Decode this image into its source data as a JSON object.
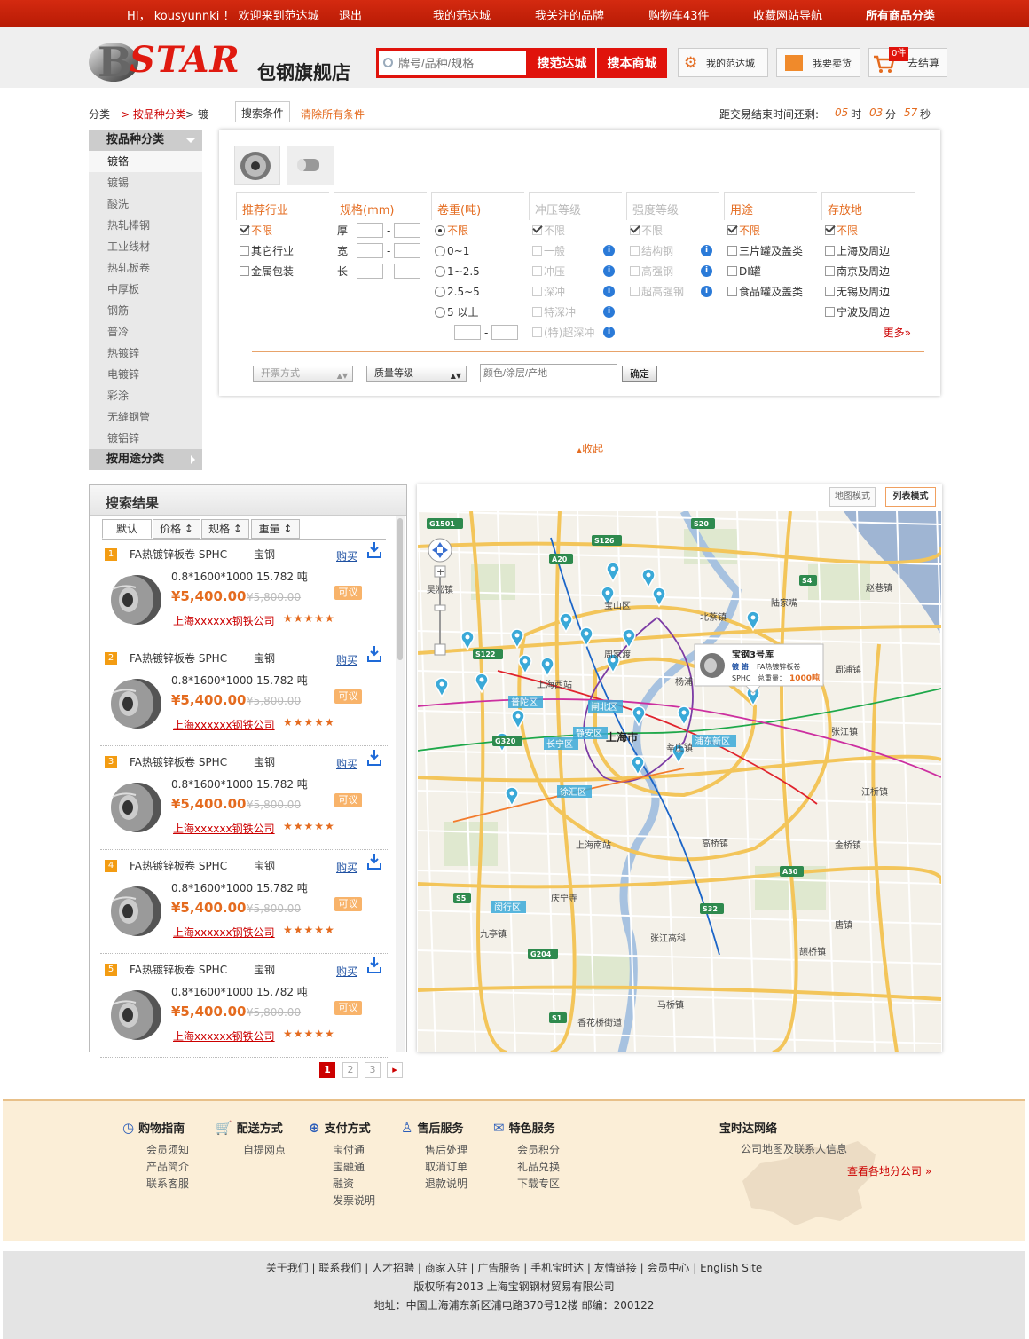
{
  "topbar": {
    "greeting": "HI， kousyunnki ！ 欢迎来到范达城",
    "logout": "退出",
    "my_fanda": "我的范达城",
    "followed_brands": "我关注的品牌",
    "cart": "购物车43件",
    "fav_nav": "收藏网站导航",
    "all_categories": "所有商品分类"
  },
  "header": {
    "logo_text": "STAR",
    "logo_cn": "包钢旗舰店",
    "search_placeholder": "牌号/品种/规格",
    "search_fanda": "搜范达城",
    "search_store": "搜本商城",
    "my_fanda_btn": "我的范达城",
    "sell_btn": "我要卖货",
    "cart_count": "0件",
    "checkout_btn": "去结算"
  },
  "breadcrumb": {
    "root": "分类",
    "level1": "> 按品种分类",
    "level2": "> 镀",
    "search_cond": "搜索条件",
    "clear_all": "清除所有条件",
    "countdown_label": "距交易结束时间还剩:",
    "hours": "05",
    "hours_unit": "时",
    "minutes": "03",
    "minutes_unit": "分",
    "seconds": "57",
    "seconds_unit": "秒"
  },
  "leftcat": {
    "head1": "按品种分类",
    "items": [
      "镀铬",
      "镀锡",
      "酸洗",
      "热轧棒钢",
      "工业线材",
      "热轧板卷",
      "中厚板",
      "钢筋",
      "普冷",
      "热镀锌",
      "电镀锌",
      "彩涂",
      "无缝钢管",
      "镀铝锌"
    ],
    "head2": "按用途分类"
  },
  "filter": {
    "industry": {
      "title": "推荐行业",
      "opts": [
        "不限",
        "其它行业",
        "金属包装"
      ]
    },
    "spec": {
      "title": "规格(mm)",
      "thick": "厚",
      "width": "宽",
      "length": "长",
      "dash": "-"
    },
    "weight": {
      "title": "卷重(吨)",
      "opts": [
        "不限",
        "0~1",
        "1~2.5",
        "2.5~5",
        "5 以上"
      ],
      "dash": "-"
    },
    "stamping": {
      "title": "冲压等级",
      "opts": [
        "不限",
        "一般",
        "冲压",
        "深冲",
        "特深冲",
        "(特)超深冲"
      ]
    },
    "strength": {
      "title": "强度等级",
      "opts": [
        "不限",
        "结构钢",
        "高强钢",
        "超高强钢"
      ]
    },
    "usage": {
      "title": "用途",
      "opts": [
        "不限",
        "三片罐及盖类",
        "DI罐",
        "食品罐及盖类"
      ]
    },
    "location": {
      "title": "存放地",
      "opts": [
        "不限",
        "上海及周边",
        "南京及周边",
        "无锡及周边",
        "宁波及周边"
      ],
      "more": "更多»"
    },
    "invoice_select": "开票方式",
    "quality_select": "质量等级",
    "extra_placeholder": "颜色/涂层/产地",
    "confirm": "确定",
    "collapse": "收起"
  },
  "results": {
    "title": "搜索结果",
    "sorts": [
      "默认",
      "价格 ↕",
      "规格 ↕",
      "重量 ↕"
    ],
    "items": [
      {
        "num": "1",
        "name": "FA热镀锌板卷 SPHC",
        "brand": "宝钢",
        "buy": "购买",
        "spec": "0.8*1600*1000   15.782 吨",
        "price": "¥5,400.00",
        "old_price": "¥5,800.00",
        "negotiable": "可议",
        "company": "上海xxxxxx钢铁公司",
        "stars": "★★★★★"
      },
      {
        "num": "2",
        "name": "FA热镀锌板卷 SPHC",
        "brand": "宝钢",
        "buy": "购买",
        "spec": "0.8*1600*1000   15.782 吨",
        "price": "¥5,400.00",
        "old_price": "¥5,800.00",
        "negotiable": "可议",
        "company": "上海xxxxxx钢铁公司",
        "stars": "★★★★★"
      },
      {
        "num": "3",
        "name": "FA热镀锌板卷 SPHC",
        "brand": "宝钢",
        "buy": "购买",
        "spec": "0.8*1600*1000   15.782 吨",
        "price": "¥5,400.00",
        "old_price": "¥5,800.00",
        "negotiable": "可议",
        "company": "上海xxxxxx钢铁公司",
        "stars": "★★★★★"
      },
      {
        "num": "4",
        "name": "FA热镀锌板卷 SPHC",
        "brand": "宝钢",
        "buy": "购买",
        "spec": "0.8*1600*1000   15.782 吨",
        "price": "¥5,400.00",
        "old_price": "¥5,800.00",
        "negotiable": "可议",
        "company": "上海xxxxxx钢铁公司",
        "stars": "★★★★★"
      },
      {
        "num": "5",
        "name": "FA热镀锌板卷 SPHC",
        "brand": "宝钢",
        "buy": "购买",
        "spec": "0.8*1600*1000   15.782 吨",
        "price": "¥5,400.00",
        "old_price": "¥5,800.00",
        "negotiable": "可议",
        "company": "上海xxxxxx钢铁公司",
        "stars": "★★★★★"
      }
    ],
    "pages": [
      "1",
      "2",
      "3"
    ],
    "next": "▸"
  },
  "map": {
    "mode_map": "地图模式",
    "mode_list": "列表模式",
    "popup_title": "宝钢3号库",
    "popup_type": "镀 铬",
    "popup_name": "FA热镀锌板卷",
    "popup_grade": "SPHC",
    "popup_total_label": "总重量：",
    "popup_total": "1000吨",
    "city": "上海市",
    "labels": [
      "普陀区",
      "闸北区",
      "静安区",
      "长宁区",
      "徐汇区",
      "浦东新区",
      "闵行区",
      "杨浦",
      "陆家嘴",
      "上海西站",
      "上海南站",
      "张江镇",
      "周浦镇",
      "北蔡镇",
      "庆宁寺",
      "高桥镇",
      "宝山区",
      "吴淞镇",
      "张江高科",
      "九亭镇",
      "莘庄镇",
      "马桥镇",
      "颉桥镇",
      "金桥镇",
      "唐镇",
      "江桥镇",
      "赵巷镇",
      "香花桥街道",
      "周家渡"
    ],
    "shields": [
      "G1501",
      "S20",
      "A20",
      "S4",
      "G320",
      "S5",
      "S32",
      "S1",
      "A30",
      "G204",
      "S126",
      "S122"
    ]
  },
  "footer": {
    "cols": [
      {
        "title": "购物指南",
        "links": [
          "会员须知",
          "产品简介",
          "联系客服"
        ]
      },
      {
        "title": "配送方式",
        "links": [
          "自提网点"
        ]
      },
      {
        "title": "支付方式",
        "links": [
          "宝付通",
          "宝融通",
          "融资",
          "发票说明"
        ]
      },
      {
        "title": "售后服务",
        "links": [
          "售后处理",
          "取消订单",
          "退款说明"
        ]
      },
      {
        "title": "特色服务",
        "links": [
          "会员积分",
          "礼品兑换",
          "下载专区"
        ]
      }
    ],
    "network_title": "宝时达网络",
    "network_sub": "公司地图及联系人信息",
    "network_link": "查看各地分公司 »",
    "links_line": "关于我们 | 联系我们 | 人才招聘 | 商家入驻 | 广告服务 | 手机宝时达 | 友情链接 | 会员中心 | English Site",
    "copyright": "版权所有2013 上海宝钢钢材贸易有限公司",
    "address": "地址：中国上海浦东新区浦电路370号12楼 邮编：200122"
  },
  "colors": {
    "brand_red": "#e0130c",
    "accent_orange": "#e46b1f",
    "link_blue": "#1e50a2"
  }
}
